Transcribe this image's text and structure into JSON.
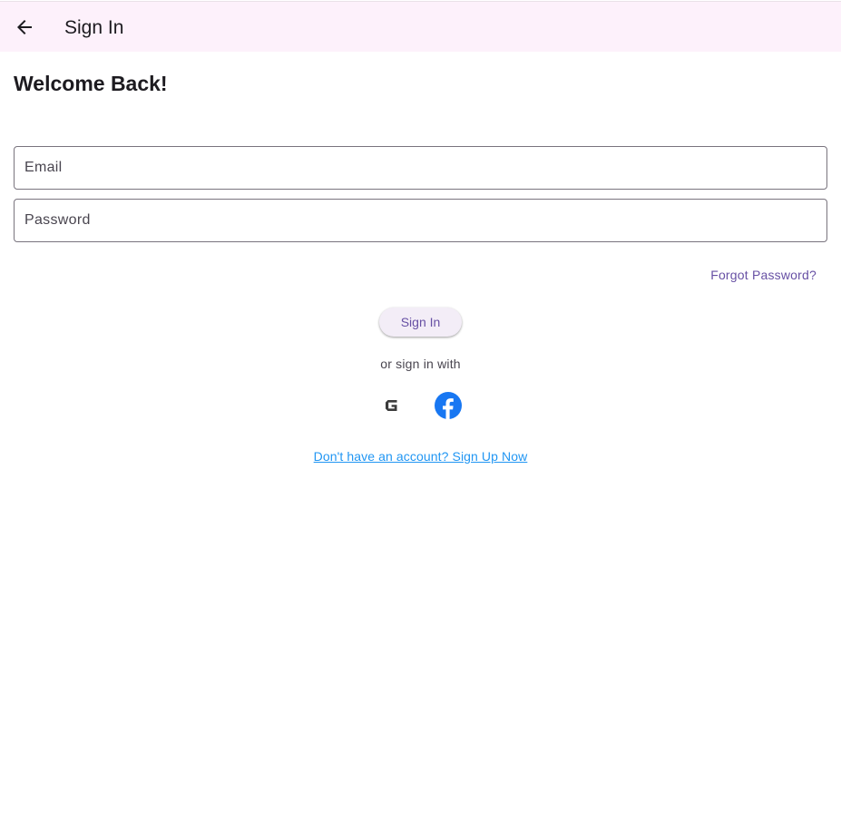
{
  "app_bar": {
    "title": "Sign In",
    "back_icon": "arrow-back-icon"
  },
  "main": {
    "heading": "Welcome Back!",
    "email_field": {
      "placeholder": "Email",
      "value": ""
    },
    "password_field": {
      "placeholder": "Password",
      "value": ""
    },
    "forgot_password_label": "Forgot Password?",
    "sign_in_label": "Sign In",
    "or_text": "or sign in with",
    "social": {
      "google_icon": "google-icon",
      "facebook_icon": "facebook-icon"
    },
    "signup_label": "Don't have an account? Sign Up Now"
  },
  "colors": {
    "app_bar_bg": "#fdf1fb",
    "primary": "#6750a4",
    "link": "#2196f3",
    "facebook": "#1877f2"
  }
}
